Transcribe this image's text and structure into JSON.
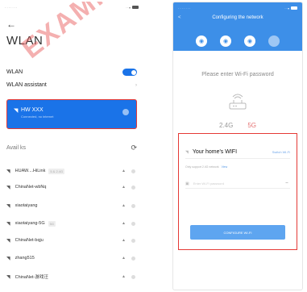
{
  "left_phone": {
    "status_dots": "·······",
    "status_right": "·· ▾",
    "back_icon": "←",
    "title": "WLAN",
    "watermark": "EXAMPLE",
    "wlan_label": "WLAN",
    "wlan_enabled": true,
    "wlan_assistant_label": "WLAN assistant",
    "chevron": "›",
    "connected": {
      "name": "HW XXX",
      "sub": "Connected, no internet"
    },
    "available_label": "Avail        ks",
    "refresh_icon": "⟳",
    "networks": [
      {
        "name": "HUAW....HiLink",
        "badge": "5 & 2.4G"
      },
      {
        "name": "ChinaNet-wbNq",
        "badge": ""
      },
      {
        "name": "xiaotaiyang",
        "badge": ""
      },
      {
        "name": "xiaotaiyang-5G",
        "badge": "5G"
      },
      {
        "name": "ChinaNet-bqju",
        "badge": ""
      },
      {
        "name": "zhang515",
        "badge": ""
      },
      {
        "name": "ChinaNet-游戏汪",
        "badge": ""
      }
    ]
  },
  "right_phone": {
    "status_dots": "·······",
    "status_right": "·· ▾",
    "header_title": "Configuring the network",
    "back_icon": "<",
    "steps": [
      "◉",
      "◉",
      "◉",
      ""
    ],
    "prompt": "Please enter Wi-Fi password",
    "band_24": "2.4G",
    "band_5": "5G",
    "ssid_value": "Your home's WIFI",
    "switch_link": "Switch Wi-Fi",
    "hint_text": "Only support 2.4G network",
    "hint_view": "View",
    "password_placeholder": "Enter Wi-Fi password",
    "eye_icon": "⌣",
    "configure_button": "CONFIGURE WI-FI"
  },
  "colors": {
    "primary_blue": "#1a73e8",
    "header_blue": "#3d8fe8",
    "highlight_red": "#e53935"
  }
}
